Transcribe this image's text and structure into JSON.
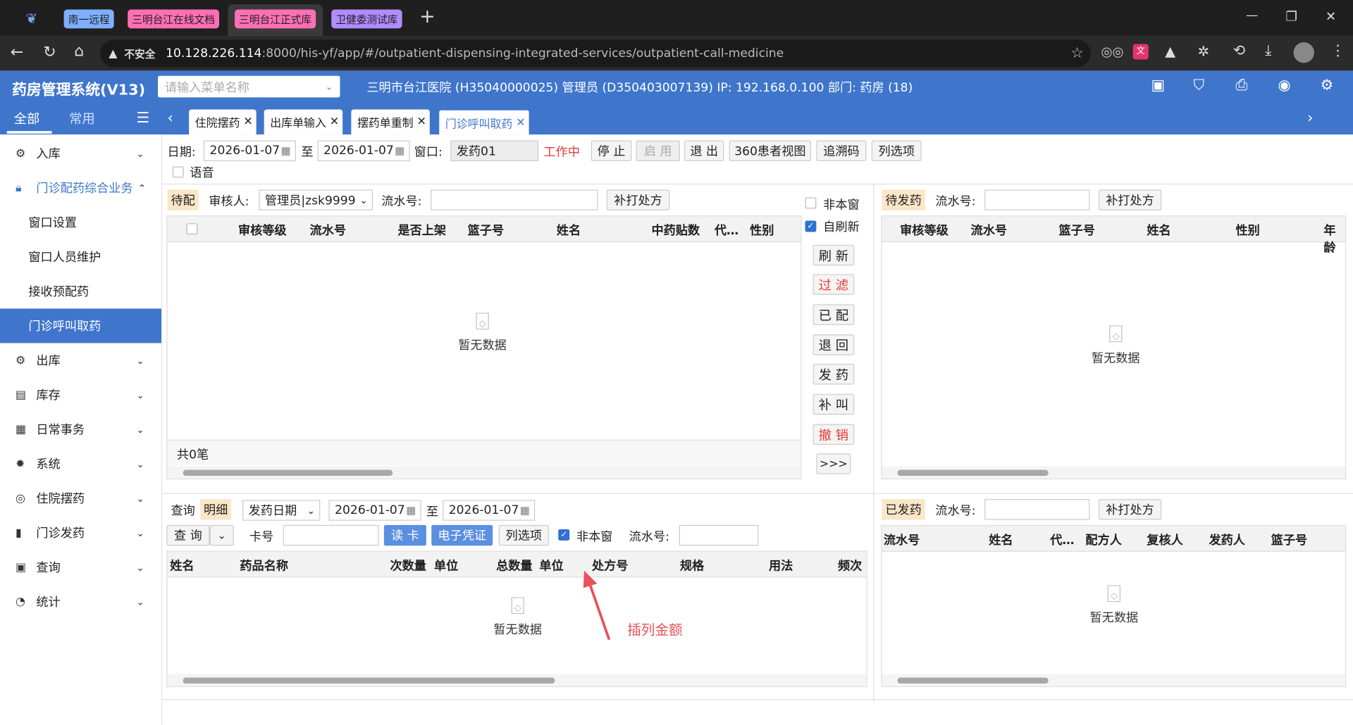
{
  "browser": {
    "groups": [
      "南一远程",
      "三明台江在线文档",
      "三明台江正式库",
      "卫健委测试库"
    ],
    "new_tab": "+",
    "not_secure": "不安全",
    "url_host": "10.128.226.114",
    "url_rest": ":8000/his-yf/app/#/outpatient-dispensing-integrated-services/outpatient-call-medicine",
    "win_min": "—",
    "win_max": "❐",
    "win_close": "✕"
  },
  "app": {
    "title": "药房管理系统(V13)",
    "menu_search_placeholder": "请输入菜单名称",
    "info": "三明市台江医院 (H35040000025) 管理员 (D350403007139) IP: 192.168.0.100 部门: 药房 (18)"
  },
  "nav": {
    "all": "全部",
    "common": "常用",
    "tabs": [
      "住院摆药",
      "出库单输入",
      "摆药单重制",
      "门诊呼叫取药"
    ]
  },
  "sidebar": {
    "items": [
      {
        "label": "入库",
        "icon": "inbound-icon"
      },
      {
        "label": "门诊配药综合业务",
        "icon": "lock-icon"
      },
      {
        "label": "窗口设置"
      },
      {
        "label": "窗口人员维护"
      },
      {
        "label": "接收预配药"
      },
      {
        "label": "门诊呼叫取药"
      },
      {
        "label": "出库",
        "icon": "outbound-icon"
      },
      {
        "label": "库存",
        "icon": "stock-icon"
      },
      {
        "label": "日常事务",
        "icon": "daily-icon"
      },
      {
        "label": "系统",
        "icon": "gear-icon"
      },
      {
        "label": "住院摆药",
        "icon": "ward-icon"
      },
      {
        "label": "门诊发药",
        "icon": "dispense-icon"
      },
      {
        "label": "查询",
        "icon": "query-icon"
      },
      {
        "label": "统计",
        "icon": "stats-icon"
      }
    ]
  },
  "toolbar": {
    "date_label": "日期:",
    "date_from": "2026-01-07",
    "to_label": "至",
    "date_to": "2026-01-07",
    "window_label": "窗口:",
    "window_value": "发药01",
    "working": "工作中",
    "stop": "停 止",
    "enable": "启 用",
    "exit": "退 出",
    "view360": "360患者视图",
    "trace": "追溯码",
    "columns": "列选项",
    "voice": "语音"
  },
  "pending": {
    "tag": "待配",
    "reviewer_label": "审核人:",
    "reviewer_value": "管理员|zsk9999",
    "serial_label": "流水号:",
    "reprint": "补打处方",
    "columns": [
      "审核等级",
      "流水号",
      "是否上架",
      "篮子号",
      "姓名",
      "中药贴数",
      "代…",
      "性别"
    ],
    "empty": "暂无数据",
    "total": "共0笔"
  },
  "actions": {
    "non_window": "非本窗",
    "auto_refresh": "自刷新",
    "refresh": "刷 新",
    "filter": "过 滤",
    "matched": "已 配",
    "back": "退 回",
    "dispense": "发 药",
    "recall": "补 叫",
    "cancel": "撤 销",
    "more": ">>>"
  },
  "to_dispense": {
    "tag": "待发药",
    "serial_label": "流水号:",
    "reprint": "补打处方",
    "columns": [
      "审核等级",
      "流水号",
      "篮子号",
      "姓名",
      "性别",
      "年龄"
    ],
    "empty": "暂无数据"
  },
  "detail": {
    "query_tab": "查询",
    "detail_tab": "明细",
    "date_type": "发药日期",
    "date_from": "2026-01-07",
    "to_label": "至",
    "date_to": "2026-01-07",
    "query_btn": "查 询",
    "card_label": "卡号",
    "read_card": "读 卡",
    "e_voucher": "电子凭证",
    "columns_btn": "列选项",
    "non_window": "非本窗",
    "serial_label": "流水号:",
    "columns": [
      "姓名",
      "药品名称",
      "次数量",
      "单位",
      "总数量",
      "单位",
      "处方号",
      "规格",
      "用法",
      "频次"
    ],
    "empty": "暂无数据",
    "annotation": "插列金额"
  },
  "dispensed": {
    "tag": "已发药",
    "serial_label": "流水号:",
    "reprint": "补打处方",
    "columns": [
      "流水号",
      "姓名",
      "代…",
      "配方人",
      "复核人",
      "发药人",
      "篮子号"
    ],
    "empty": "暂无数据"
  },
  "colors": {
    "accent": "#3f76cc",
    "tag_bg": "#fbe6c8",
    "danger": "#e53935",
    "annotation": "#e8505b"
  }
}
